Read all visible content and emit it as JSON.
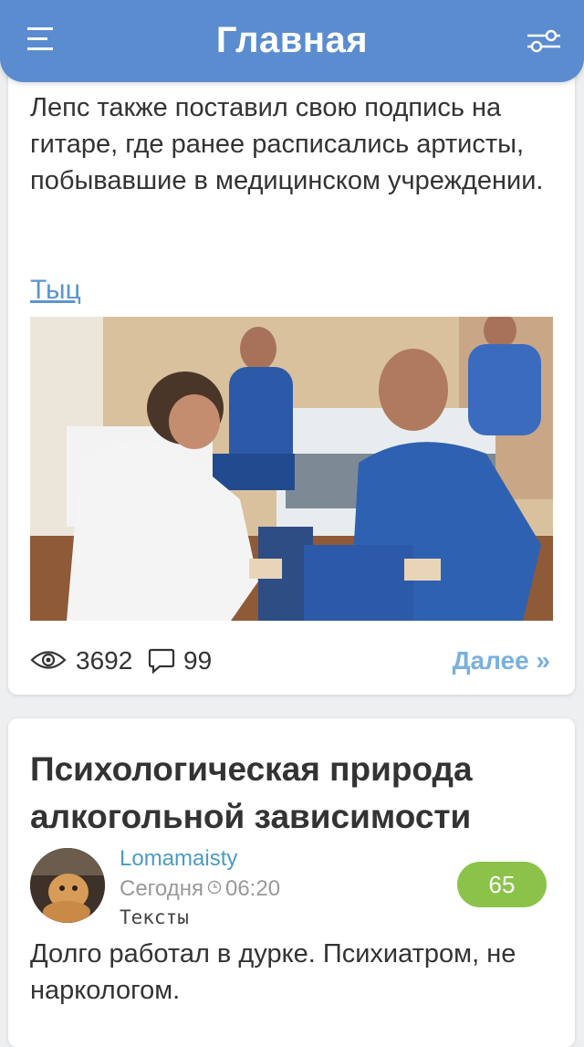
{
  "header": {
    "title": "Главная",
    "menu_icon": "hamburger-menu-icon",
    "filter_icon": "settings-sliders-icon",
    "color": "#5b8ccf"
  },
  "article1": {
    "text": "Лепс также поставил свою подпись на гитаре, где ранее расписались артисты, побывавшие в медицинском учреждении.",
    "link_text": "Тыц",
    "image_icon": "photo-hospital-patients",
    "views": "3692",
    "comments": "99",
    "more_label": "Далее »"
  },
  "post2": {
    "title": "Психологическая природа алкогольной зависимости",
    "author": "Lomamaisty",
    "time_prefix": "Сегодня",
    "time": "06:20",
    "category": "Тексты",
    "rating": "65",
    "rating_color": "#8bc34a",
    "excerpt": "Долго работал в дурке. Психиатром, не наркологом."
  }
}
